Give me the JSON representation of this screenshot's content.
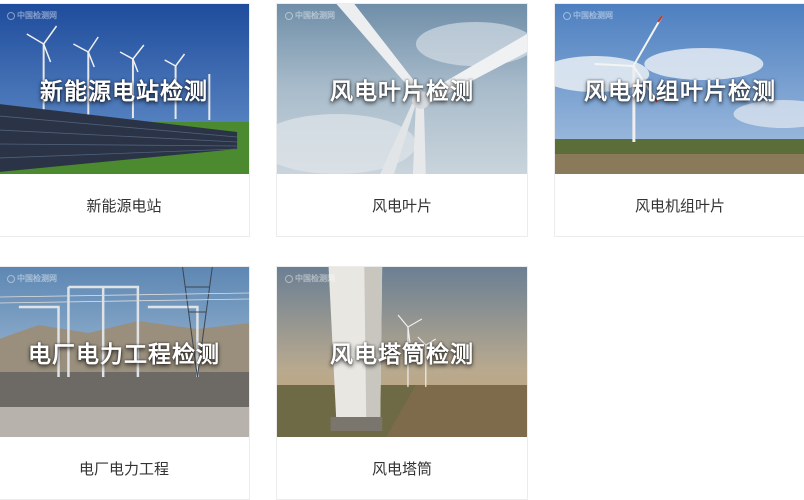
{
  "cards": [
    {
      "overlay": "新能源电站检测",
      "caption": "新能源电站",
      "watermark": "中国检测网"
    },
    {
      "overlay": "风电叶片检测",
      "caption": "风电叶片",
      "watermark": "中国检测网"
    },
    {
      "overlay": "风电机组叶片检测",
      "caption": "风电机组叶片",
      "watermark": "中国检测网"
    },
    {
      "overlay": "电厂电力工程检测",
      "caption": "电厂电力工程",
      "watermark": "中国检测网"
    },
    {
      "overlay": "风电塔筒检测",
      "caption": "风电塔筒",
      "watermark": "中国检测网"
    }
  ],
  "colors": {
    "caption_text": "#333333",
    "card_border": "#ececec",
    "overlay_text": "#ffffff"
  }
}
